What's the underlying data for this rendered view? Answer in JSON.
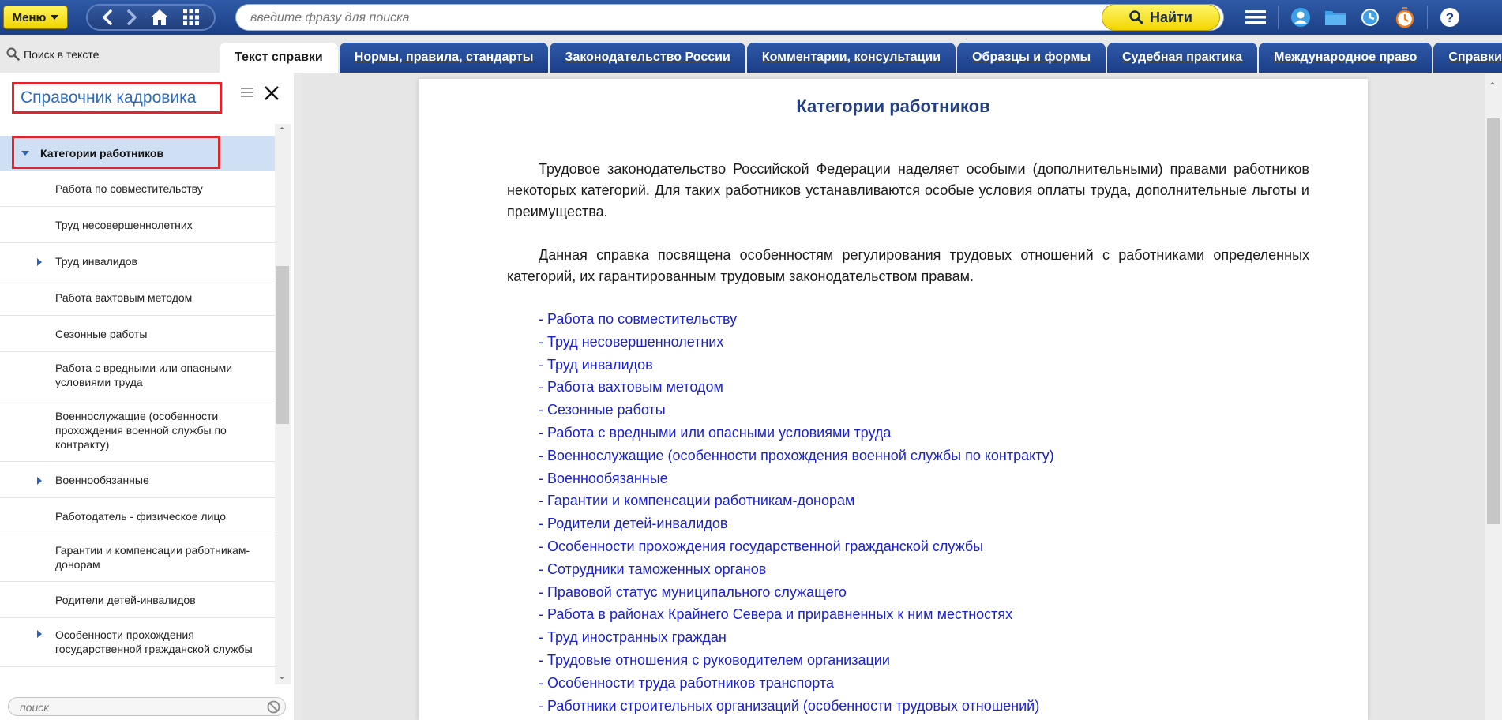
{
  "topbar": {
    "menu_label": "Меню",
    "search_placeholder": "введите фразу для поиска",
    "find_label": "Найти"
  },
  "tabbar": {
    "find_in_text": "Поиск в тексте",
    "tabs": [
      {
        "label": "Текст справки",
        "active": true
      },
      {
        "label": "Нормы, правила, стандарты"
      },
      {
        "label": "Законодательство России"
      },
      {
        "label": "Комментарии, консультации"
      },
      {
        "label": "Образцы и формы"
      },
      {
        "label": "Судебная практика"
      },
      {
        "label": "Международное право"
      },
      {
        "label": "Справки"
      }
    ]
  },
  "sidebar": {
    "title": "Справочник кадровика",
    "current": "Категории работников",
    "items": [
      {
        "label": "Работа по совместительству"
      },
      {
        "label": "Труд несовершеннолетних"
      },
      {
        "label": "Труд инвалидов",
        "expandable": true
      },
      {
        "label": "Работа вахтовым методом"
      },
      {
        "label": "Сезонные работы"
      },
      {
        "label": "Работа с вредными или опасными условиями труда"
      },
      {
        "label": "Военнослужащие (особенности прохождения военной службы по контракту)"
      },
      {
        "label": "Военнообязанные",
        "expandable": true
      },
      {
        "label": "Работодатель - физическое лицо"
      },
      {
        "label": "Гарантии и компенсации работникам-донорам"
      },
      {
        "label": "Родители детей-инвалидов"
      },
      {
        "label": "Особенности прохождения государственной гражданской службы",
        "expandable": true
      }
    ],
    "search_placeholder": "поиск"
  },
  "document": {
    "title": "Категории работников",
    "paragraphs": [
      "Трудовое законодательство Российской Федерации наделяет особыми (дополнительными) правами работников некоторых категорий. Для таких работников устанавливаются особые условия оплаты труда, дополнительные льготы и преимущества.",
      "Данная справка посвящена особенностям регулирования трудовых отношений с работниками определенных категорий, их гарантированным трудовым законодательством правам."
    ],
    "links": [
      "- Работа по совместительству",
      "- Труд несовершеннолетних",
      "- Труд инвалидов",
      "- Работа вахтовым методом",
      "- Сезонные работы",
      "- Работа с вредными или опасными условиями труда",
      "- Военнослужащие (особенности прохождения военной службы по контракту)",
      "- Военнообязанные",
      "- Гарантии и компенсации работникам-донорам",
      "- Родители детей-инвалидов",
      "- Особенности прохождения государственной гражданской службы",
      "- Сотрудники таможенных органов",
      "- Правовой статус муниципального служащего",
      "- Работа в районах Крайнего Севера и приравненных к ним местностях",
      "- Труд иностранных граждан",
      "- Трудовые отношения с руководителем организации",
      "- Особенности труда работников транспорта",
      "- Работники строительных организаций (особенности трудовых отношений)"
    ]
  },
  "colors": {
    "topbar": "#1f4590",
    "accent_yellow": "#f6e21a",
    "link": "#1b22c8",
    "highlight_outline": "#e0242b"
  }
}
